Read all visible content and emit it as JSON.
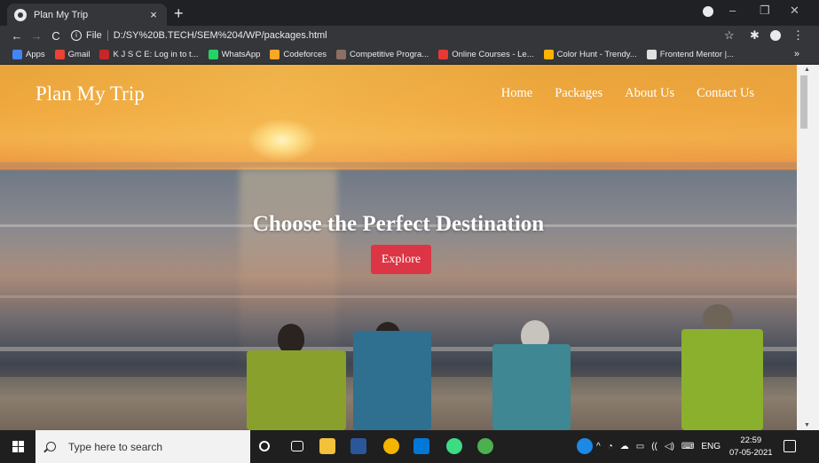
{
  "browser": {
    "tab_title": "Plan My Trip",
    "tab_close": "×",
    "new_tab": "+",
    "back": "←",
    "forward": "→",
    "reload": "C",
    "info": "i",
    "file_label": "File",
    "url": "D:/SY%20B.TECH/SEM%204/WP/packages.html",
    "star": "☆",
    "menu": "⋮",
    "minimize": "–",
    "restore": "❐",
    "close": "✕"
  },
  "bookmarks": [
    {
      "label": "Apps",
      "color": "#4285f4"
    },
    {
      "label": "Gmail",
      "color": "#ea4335"
    },
    {
      "label": "K J S C E: Log in to t...",
      "color": "#c62828"
    },
    {
      "label": "WhatsApp",
      "color": "#25d366"
    },
    {
      "label": "Codeforces",
      "color": "#f9a825"
    },
    {
      "label": "Competitive Progra...",
      "color": "#8d6e63"
    },
    {
      "label": "Online Courses - Le...",
      "color": "#e53935"
    },
    {
      "label": "Color Hunt - Trendy...",
      "color": "#ffb300"
    },
    {
      "label": "Frontend Mentor |...",
      "color": "#e0e0e0"
    }
  ],
  "bookmarks_more": "»",
  "site": {
    "brand": "Plan My Trip",
    "nav": [
      "Home",
      "Packages",
      "About Us",
      "Contact Us"
    ],
    "hero_title": "Choose the Perfect Destination",
    "explore_label": "Explore",
    "accent": "#dc3545"
  },
  "taskbar": {
    "search_placeholder": "Type here to search",
    "language": "ENG",
    "time": "22:59",
    "date": "07-05-2021"
  }
}
